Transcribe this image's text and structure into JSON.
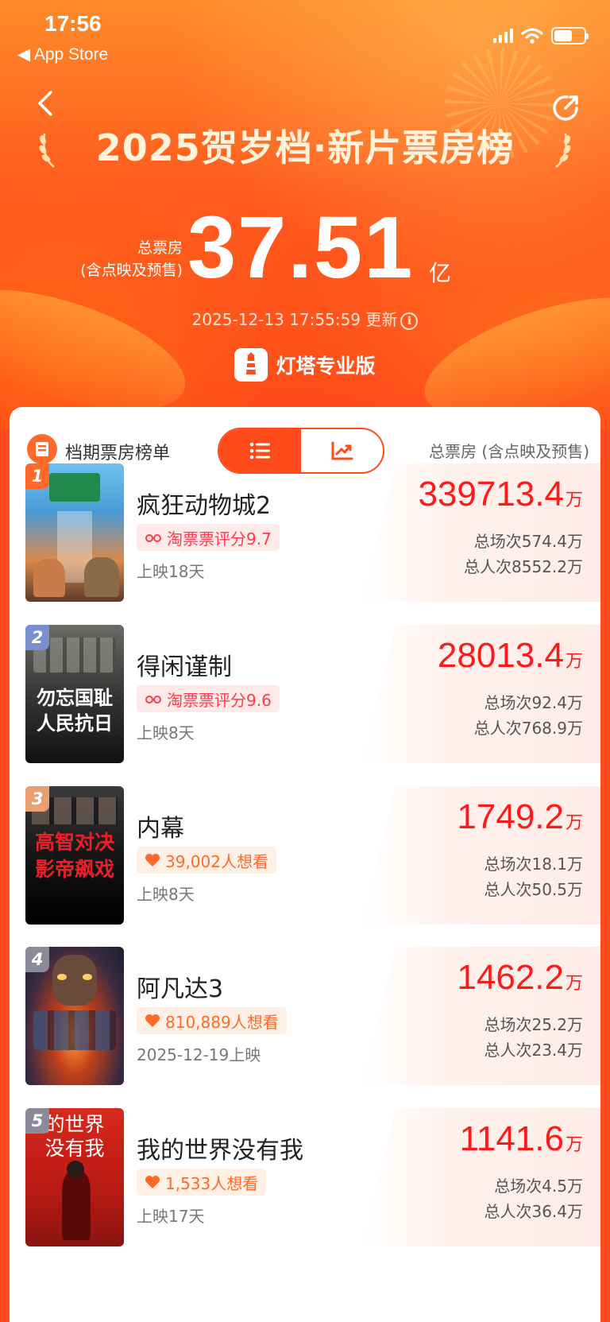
{
  "status_bar": {
    "time": "17:56",
    "back_label": "◀ App Store"
  },
  "header": {
    "title": "2025贺岁档·新片票房榜",
    "total_label_line1": "总票房",
    "total_label_line2": "(含点映及预售)",
    "total_value": "37.51",
    "total_unit": "亿",
    "update_text": "2025-12-13 17:55:59 更新",
    "brand": "灯塔专业版"
  },
  "panel": {
    "section_title": "档期票房榜单",
    "column_note": "总票房 (含点映及预售)",
    "view_modes": [
      "list",
      "chart"
    ]
  },
  "colors": {
    "accent": "#ff4a1c",
    "box_office_red": "#ff1a1a",
    "score_tag": "#ff3a4a",
    "want_tag": "#ff6a2a"
  },
  "movies": [
    {
      "rank": "1",
      "title": "疯狂动物城2",
      "tag": "淘票票评分9.7",
      "tag_type": "score",
      "release": "上映18天",
      "box_value": "339713.4",
      "box_unit": "万",
      "screenings": "总场次574.4万",
      "admissions": "总人次8552.2万",
      "poster_text": "",
      "rank_color": "#ff6a2a"
    },
    {
      "rank": "2",
      "title": "得闲谨制",
      "tag": "淘票票评分9.6",
      "tag_type": "score",
      "release": "上映8天",
      "box_value": "28013.4",
      "box_unit": "万",
      "screenings": "总场次92.4万",
      "admissions": "总人次768.9万",
      "poster_text": "勿忘国耻\n人民抗日",
      "rank_color": "#7a8fd0"
    },
    {
      "rank": "3",
      "title": "内幕",
      "tag": "39,002人想看",
      "tag_type": "want",
      "release": "上映8天",
      "box_value": "1749.2",
      "box_unit": "万",
      "screenings": "总场次18.1万",
      "admissions": "总人次50.5万",
      "poster_text": "高智对决\n影帝飙戏",
      "rank_color": "#e8a070"
    },
    {
      "rank": "4",
      "title": "阿凡达3",
      "tag": "810,889人想看",
      "tag_type": "want",
      "release": "2025-12-19上映",
      "box_value": "1462.2",
      "box_unit": "万",
      "screenings": "总场次25.2万",
      "admissions": "总人次23.4万",
      "poster_text": "",
      "rank_color": "#8a8a9a"
    },
    {
      "rank": "5",
      "title": "我的世界没有我",
      "tag": "1,533人想看",
      "tag_type": "want",
      "release": "上映17天",
      "box_value": "1141.6",
      "box_unit": "万",
      "screenings": "总场次4.5万",
      "admissions": "总人次36.4万",
      "poster_text": "的世界\n没有我",
      "rank_color": "#8a8a9a"
    }
  ]
}
